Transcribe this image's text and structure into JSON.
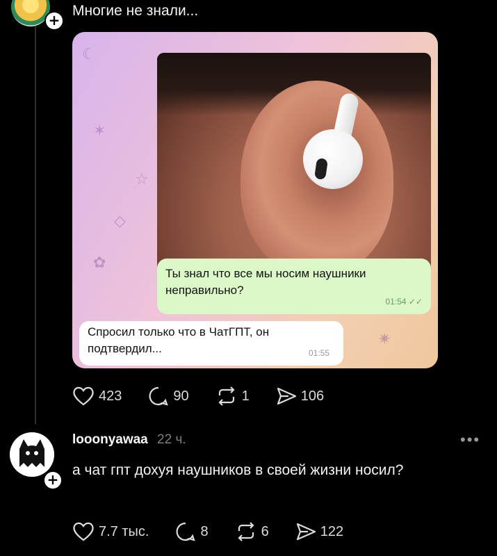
{
  "post": {
    "text": "Многие не знали...",
    "meme": {
      "message_question": "Ты знал что все мы носим наушники неправильно?",
      "message_question_time": "01:54",
      "message_answer": "Спросил только что в ЧатГПТ, он подтвердил...",
      "message_answer_time": "01:55"
    },
    "stats": {
      "likes": "423",
      "replies": "90",
      "reposts": "1",
      "shares": "106"
    }
  },
  "comment": {
    "username": "looonyawaa",
    "time": "22 ч.",
    "text": "а чат гпт дохуя наушников в своей жизни носил?",
    "more_label": "•••",
    "stats": {
      "likes": "7.7 тыс.",
      "replies": "8",
      "reposts": "6",
      "shares": "122"
    }
  },
  "icons": {
    "follow": "plus-icon",
    "like": "heart-icon",
    "reply": "speech-bubble-icon",
    "repost": "repost-icon",
    "share": "send-icon"
  },
  "colors": {
    "background": "#000000",
    "text": "#f2f2f2",
    "muted": "#7d7d7d",
    "bubble_green": "#ddf8c8"
  }
}
